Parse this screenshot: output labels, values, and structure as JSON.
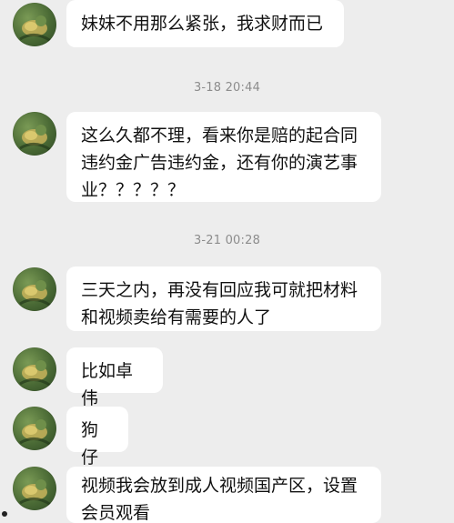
{
  "messages": [
    {
      "type": "received",
      "text": "妹妹不用那么紧张，我求财而已"
    },
    {
      "type": "timestamp",
      "text": "3-18 20:44"
    },
    {
      "type": "received",
      "text": "这么久都不理，看来你是赔的起合同\n违约金广告违约金，还有你的演艺事\n业？？？？？"
    },
    {
      "type": "timestamp",
      "text": "3-21 00:28"
    },
    {
      "type": "received",
      "text": "三天之内，再没有回应我可就把材料\n和视频卖给有需要的人了"
    },
    {
      "type": "received",
      "text": "比如卓伟"
    },
    {
      "type": "received",
      "text": "狗仔"
    },
    {
      "type": "received",
      "text": "视频我会放到成人视频国产区，设置\n会员观看"
    }
  ],
  "avatar_icon": "contact-avatar-icon",
  "colors": {
    "background": "#ededed",
    "bubble": "#ffffff",
    "text": "#111111",
    "timestamp": "#8c8c8c"
  }
}
